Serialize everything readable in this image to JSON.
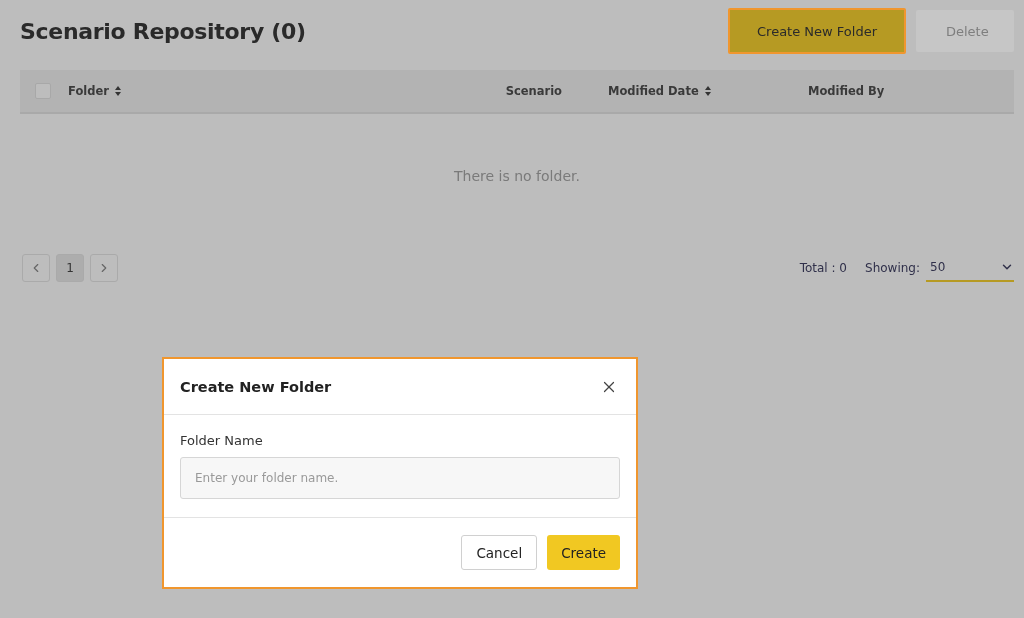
{
  "page": {
    "title": "Scenario Repository (0)"
  },
  "actions": [
    {
      "label": "Create New Folder",
      "kind": "primary",
      "highlighted": true,
      "disabled": false
    },
    {
      "label": "Delete",
      "kind": "secondary",
      "highlighted": false,
      "disabled": true
    }
  ],
  "table": {
    "select_all": {
      "checked": false
    },
    "columns": [
      {
        "label": "Folder",
        "sortable": true
      },
      {
        "label": "Scenario",
        "sortable": false
      },
      {
        "label": "Modified Date",
        "sortable": true
      },
      {
        "label": "Modified By",
        "sortable": false
      }
    ],
    "empty_message": "There is no folder."
  },
  "pagination": {
    "pages": [
      {
        "label": "1",
        "selected": true
      }
    ],
    "total": "Total : 0",
    "showing_label": "Showing:",
    "showing_value": "50"
  },
  "dialog": {
    "title": "Create New Folder",
    "field_label": "Folder Name",
    "placeholder": "Enter your folder name.",
    "buttons": [
      {
        "label": "Cancel",
        "kind": "secondary"
      },
      {
        "label": "Create",
        "kind": "primary"
      }
    ]
  }
}
